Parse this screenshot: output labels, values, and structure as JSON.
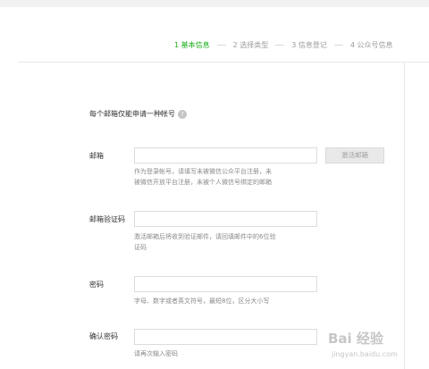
{
  "steps": [
    {
      "label": "1 基本信息",
      "active": true
    },
    {
      "label": "2 选择类型",
      "active": false
    },
    {
      "label": "3 信息登记",
      "active": false
    },
    {
      "label": "4 公众号信息",
      "active": false
    }
  ],
  "note": "每个邮箱仅能申请一种帐号",
  "help_icon_glyph": "?",
  "email": {
    "label": "邮箱",
    "value": "",
    "activate_button": "激活邮箱",
    "hint_line1": "作为登录帐号，请填写未被微信公众平台注册，未",
    "hint_line2": "被微信开放平台注册，未被个人微信号绑定的邮箱"
  },
  "verify_code": {
    "label": "邮箱验证码",
    "value": "",
    "hint_line1": "激活邮箱后将收到验证邮件，请回填邮件中的6位验",
    "hint_line2": "证码"
  },
  "password": {
    "label": "密码",
    "value": "",
    "hint": "字母、数字或者英文符号，最短8位，区分大小写"
  },
  "confirm_password": {
    "label": "确认密码",
    "value": "",
    "hint": "请再次输入密码"
  },
  "watermark": {
    "main": "Bai 经验",
    "sub": "jingyan.baidu.com"
  }
}
